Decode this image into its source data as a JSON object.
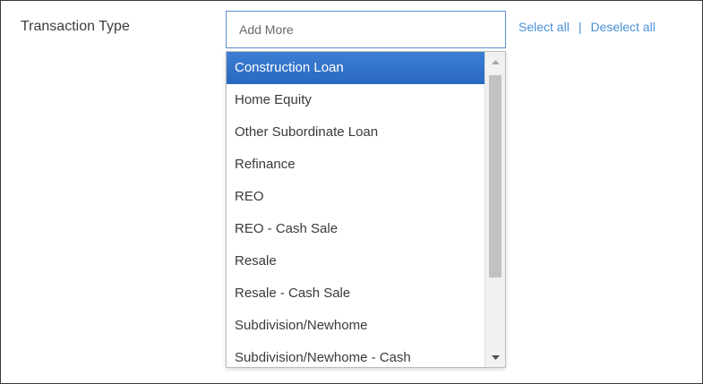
{
  "field": {
    "label": "Transaction Type",
    "placeholder": "Add More"
  },
  "links": {
    "select_all": "Select all",
    "separator": "|",
    "deselect_all": "Deselect all"
  },
  "dropdown": {
    "selected_index": 0,
    "options": [
      "Construction Loan",
      "Home Equity",
      "Other Subordinate Loan",
      "Refinance",
      "REO",
      "REO - Cash Sale",
      "Resale",
      "Resale - Cash Sale",
      "Subdivision/Newhome",
      "Subdivision/Newhome - Cash"
    ]
  },
  "colors": {
    "selected_bg": "#3b7fd4",
    "link": "#4a90d6",
    "input_border": "#5a8fd2"
  }
}
